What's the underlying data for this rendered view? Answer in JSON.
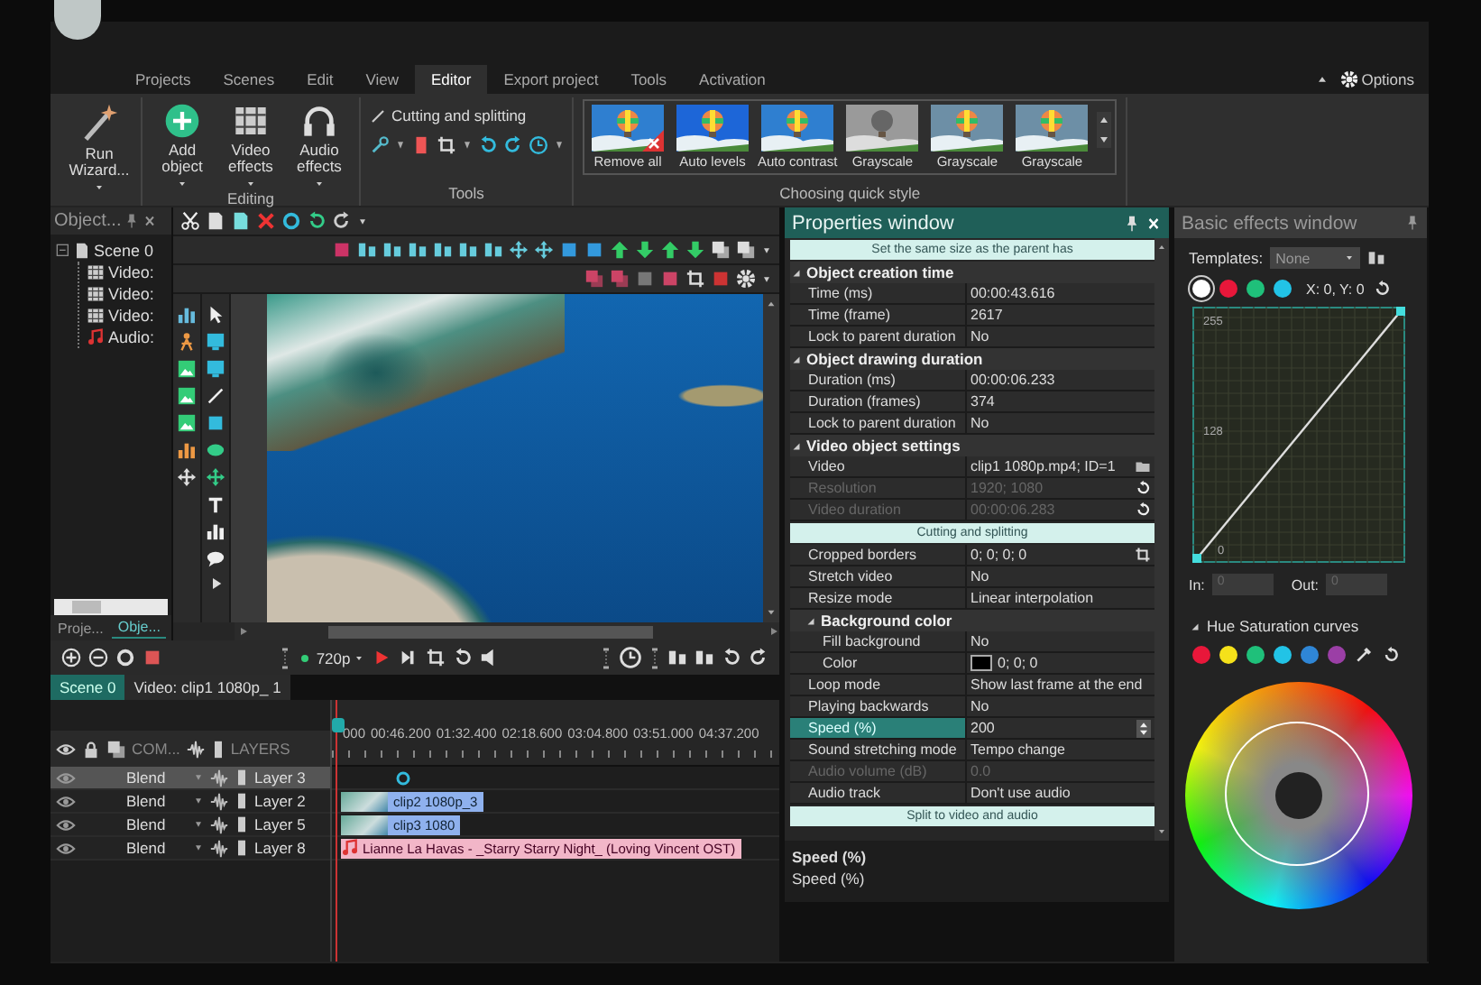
{
  "menu": {
    "tabs": [
      {
        "label": "Projects",
        "selected": false
      },
      {
        "label": "Scenes",
        "selected": false
      },
      {
        "label": "Edit",
        "selected": false
      },
      {
        "label": "View",
        "selected": false
      },
      {
        "label": "Editor",
        "selected": true
      },
      {
        "label": "Export project",
        "selected": false
      },
      {
        "label": "Tools",
        "selected": false
      },
      {
        "label": "Activation",
        "selected": false
      }
    ],
    "options": "Options"
  },
  "ribbon": {
    "wizard": "Run Wizard...",
    "editing": {
      "label": "Editing",
      "buttons": [
        {
          "label": "Add object",
          "kind": "add"
        },
        {
          "label": "Video effects",
          "kind": "film"
        },
        {
          "label": "Audio effects",
          "kind": "headphones"
        }
      ]
    },
    "tools": {
      "label": "Tools",
      "cutting": "Cutting and splitting"
    },
    "quick_style": {
      "label": "Choosing quick style",
      "styles": [
        {
          "label": "Remove all",
          "kind": "remove"
        },
        {
          "label": "Auto levels",
          "kind": "vivid"
        },
        {
          "label": "Auto contrast",
          "kind": "color"
        },
        {
          "label": "Grayscale",
          "kind": "gray"
        },
        {
          "label": "Grayscale",
          "kind": "muted"
        },
        {
          "label": "Grayscale",
          "kind": "muted"
        }
      ]
    }
  },
  "objects_panel": {
    "title": "Object...",
    "tree": [
      {
        "label": "Scene 0",
        "kind": "scene",
        "expanded": true,
        "children": [
          {
            "label": "Video:",
            "kind": "video"
          },
          {
            "label": "Video:",
            "kind": "video"
          },
          {
            "label": "Video:",
            "kind": "video"
          },
          {
            "label": "Audio:",
            "kind": "audio"
          }
        ]
      }
    ],
    "tabs": [
      {
        "label": "Proje...",
        "selected": false
      },
      {
        "label": "Obje...",
        "selected": true
      }
    ]
  },
  "timeline": {
    "resolution": "720p",
    "tabs": [
      {
        "label": "Scene 0",
        "selected": true
      },
      {
        "label": "Video: clip1 1080p_ 1",
        "selected": false
      }
    ],
    "ruler": [
      "000",
      "00:46.200",
      "01:32.400",
      "02:18.600",
      "03:04.800",
      "03:51.000",
      "04:37.200"
    ],
    "columns": [
      "COM...",
      "LAYERS"
    ],
    "layers": [
      {
        "blend": "Blend",
        "name": "Layer 3",
        "selected": true,
        "clip": {
          "kind": "marker"
        }
      },
      {
        "blend": "Blend",
        "name": "Layer 2",
        "selected": false,
        "clip": {
          "kind": "video",
          "label": "clip2 1080p_3"
        }
      },
      {
        "blend": "Blend",
        "name": "Layer 5",
        "selected": false,
        "clip": {
          "kind": "video",
          "label": "clip3 1080"
        }
      },
      {
        "blend": "Blend",
        "name": "Layer 8",
        "selected": false,
        "clip": {
          "kind": "audio",
          "label": "Lianne La Havas - _Starry Starry Night_ (Loving Vincent OST)"
        }
      }
    ]
  },
  "properties": {
    "title": "Properties window",
    "rows": [
      {
        "kind": "button",
        "label": "Set the same size as the parent has"
      },
      {
        "kind": "group",
        "label": "Object creation time",
        "expanded": true,
        "children": [
          {
            "kind": "prop",
            "name": "Time (ms)",
            "value": "00:00:43.616",
            "disabled": false,
            "selected": false
          },
          {
            "kind": "prop",
            "name": "Time (frame)",
            "value": "2617",
            "disabled": false,
            "selected": false
          },
          {
            "kind": "prop",
            "name": "Lock to parent duration",
            "value": "No",
            "disabled": false,
            "selected": false
          }
        ]
      },
      {
        "kind": "group",
        "label": "Object drawing duration",
        "expanded": true,
        "children": [
          {
            "kind": "prop",
            "name": "Duration (ms)",
            "value": "00:00:06.233",
            "disabled": false,
            "selected": false
          },
          {
            "kind": "prop",
            "name": "Duration (frames)",
            "value": "374",
            "disabled": false,
            "selected": false
          },
          {
            "kind": "prop",
            "name": "Lock to parent duration",
            "value": "No",
            "disabled": false,
            "selected": false
          }
        ]
      },
      {
        "kind": "group",
        "label": "Video object settings",
        "expanded": true,
        "children": [
          {
            "kind": "file",
            "name": "Video",
            "value": "clip1 1080p.mp4; ID=1",
            "disabled": false,
            "selected": false
          },
          {
            "kind": "reset",
            "name": "Resolution",
            "value": "1920; 1080",
            "disabled": true,
            "selected": false
          },
          {
            "kind": "reset",
            "name": "Video duration",
            "value": "00:00:06.283",
            "disabled": true,
            "selected": false
          },
          {
            "kind": "button",
            "label": "Cutting and splitting"
          },
          {
            "kind": "crop",
            "name": "Cropped borders",
            "value": "0; 0; 0; 0",
            "disabled": false,
            "selected": false
          },
          {
            "kind": "prop",
            "name": "Stretch video",
            "value": "No",
            "disabled": false,
            "selected": false
          },
          {
            "kind": "prop",
            "name": "Resize mode",
            "value": "Linear interpolation",
            "disabled": false,
            "selected": false
          },
          {
            "kind": "group",
            "label": "Background color",
            "expanded": true,
            "children": [
              {
                "kind": "prop",
                "name": "Fill background",
                "value": "No",
                "disabled": false,
                "selected": false
              },
              {
                "kind": "color",
                "name": "Color",
                "value": "0; 0; 0",
                "color": "#000000",
                "disabled": false,
                "selected": false
              }
            ]
          },
          {
            "kind": "prop",
            "name": "Loop mode",
            "value": "Show last frame at the end",
            "disabled": false,
            "selected": false
          },
          {
            "kind": "prop",
            "name": "Playing backwards",
            "value": "No",
            "disabled": false,
            "selected": false
          },
          {
            "kind": "spin",
            "name": "Speed (%)",
            "value": "200",
            "disabled": false,
            "selected": true
          },
          {
            "kind": "prop",
            "name": "Sound stretching mode",
            "value": "Tempo change",
            "disabled": false,
            "selected": false
          },
          {
            "kind": "prop",
            "name": "Audio volume (dB)",
            "value": "0.0",
            "disabled": true,
            "selected": false
          },
          {
            "kind": "prop",
            "name": "Audio track",
            "value": "Don't use audio",
            "disabled": false,
            "selected": false
          },
          {
            "kind": "button",
            "label": "Split to video and audio"
          }
        ]
      }
    ],
    "footer": {
      "title": "Speed (%)",
      "description": "Speed (%)"
    }
  },
  "effects": {
    "title": "Basic effects window",
    "templates_label": "Templates:",
    "template": "None",
    "channels": [
      {
        "color": "#ffffff",
        "selected": true
      },
      {
        "color": "#e8173a",
        "selected": false
      },
      {
        "color": "#1fc07a",
        "selected": false
      },
      {
        "color": "#22c3e6",
        "selected": false
      }
    ],
    "coords": "X: 0, Y: 0",
    "curve_labels": [
      "255",
      "128",
      "0"
    ],
    "in_label": "In:",
    "in_value": "0",
    "out_label": "Out:",
    "out_value": "0",
    "hue_title": "Hue Saturation curves",
    "hue_expanded": true,
    "hue_colors": [
      {
        "color": "#e8173a",
        "selected": false
      },
      {
        "color": "#f5e11a",
        "selected": false
      },
      {
        "color": "#1fc07a",
        "selected": false
      },
      {
        "color": "#22c3e6",
        "selected": false
      },
      {
        "color": "#2f86d6",
        "selected": false
      },
      {
        "color": "#9b3fa6",
        "selected": false
      }
    ]
  }
}
